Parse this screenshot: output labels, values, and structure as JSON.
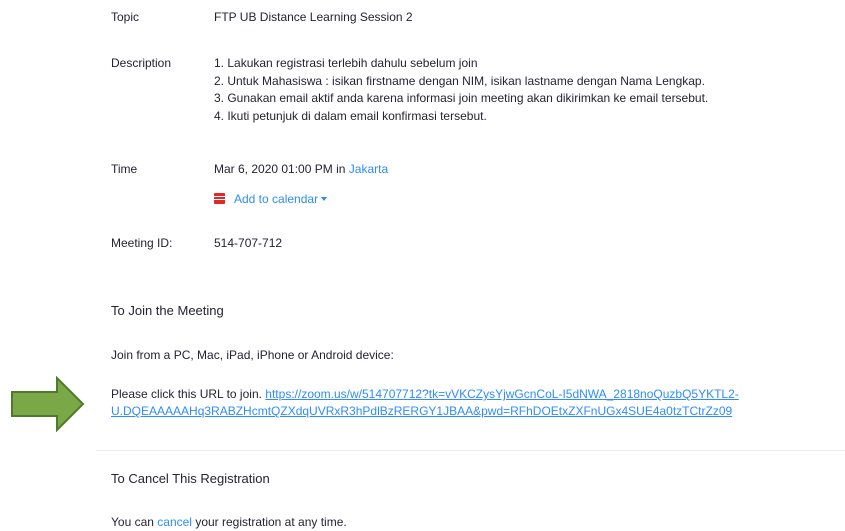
{
  "details": {
    "topic_label": "Topic",
    "topic_value": "FTP UB Distance Learning Session 2",
    "description_label": "Description",
    "description_lines": [
      "1. Lakukan registrasi terlebih dahulu sebelum join",
      "2. Untuk Mahasiswa : isikan firstname dengan NIM, isikan lastname dengan Nama Lengkap.",
      "3. Gunakan email aktif anda karena informasi join meeting akan dikirimkan ke email tersebut.",
      "4. Ikuti petunjuk di dalam email konfirmasi tersebut."
    ],
    "time_label": "Time",
    "time_value": "Mar 6, 2020 01:00 PM in",
    "timezone_link": "Jakarta",
    "add_to_calendar": "Add to calendar",
    "meeting_id_label": "Meeting ID:",
    "meeting_id_value": "514-707-712"
  },
  "join": {
    "title": "To Join the Meeting",
    "devices_text": "Join from a PC, Mac, iPad, iPhone or Android device:",
    "click_prefix": "Please click this URL to join.",
    "url_line1": "https://zoom.us/w/514707712?tk=vVKCZysYjwGcnCoL-I5dNWA_2818noQuzbQ5YKTL2-",
    "url_line2": "U.DQEAAAAAHq3RABZHcmtQZXdqUVRxR3hPdlBzRERGY1JBAA&pwd=RFhDOEtxZXFnUGx4SUE4a0tzTCtrZz09"
  },
  "cancel": {
    "title": "To Cancel This Registration",
    "text_prefix": "You can",
    "cancel_link": "cancel",
    "text_suffix": "your registration at any time."
  },
  "colors": {
    "link": "#2d8cff",
    "calendar_icon": "#e02828",
    "arrow_fill": "#7aa846",
    "arrow_stroke": "#4f7a2a"
  },
  "icons": {
    "calendar": "calendar-icon",
    "caret": "chevron-down-icon",
    "arrow": "arrow-right-icon"
  }
}
